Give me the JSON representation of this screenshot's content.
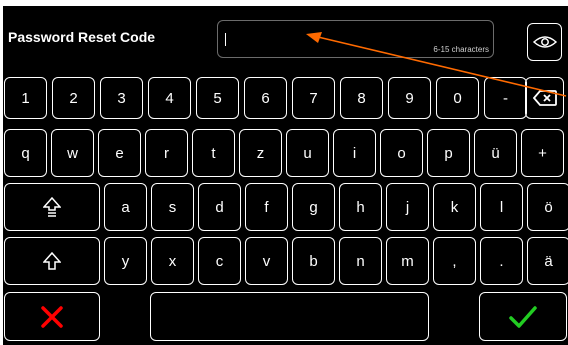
{
  "header": {
    "title": "Password Reset Code",
    "hint": "6-15 characters",
    "password_value": ""
  },
  "keyboard": {
    "row1": [
      "1",
      "2",
      "3",
      "4",
      "5",
      "6",
      "7",
      "8",
      "9",
      "0",
      "-"
    ],
    "row2": [
      "q",
      "w",
      "e",
      "r",
      "t",
      "z",
      "u",
      "i",
      "o",
      "p",
      "ü",
      "+"
    ],
    "row3": [
      "a",
      "s",
      "d",
      "f",
      "g",
      "h",
      "j",
      "k",
      "l",
      "ö"
    ],
    "row4": [
      "y",
      "x",
      "c",
      "v",
      "b",
      "n",
      "m",
      ",",
      ".",
      "ä"
    ]
  },
  "colors": {
    "background": "#000000",
    "key_border": "#ffffff",
    "cancel": "#ff0000",
    "confirm": "#22cc22",
    "annotation_arrow": "#ff6a00"
  },
  "icons": {
    "show_password": "eye-icon",
    "backspace": "backspace-icon",
    "shift": "shift-icon",
    "caps_lock": "caps-lock-icon",
    "cancel": "cancel-x-icon",
    "confirm": "checkmark-icon"
  }
}
